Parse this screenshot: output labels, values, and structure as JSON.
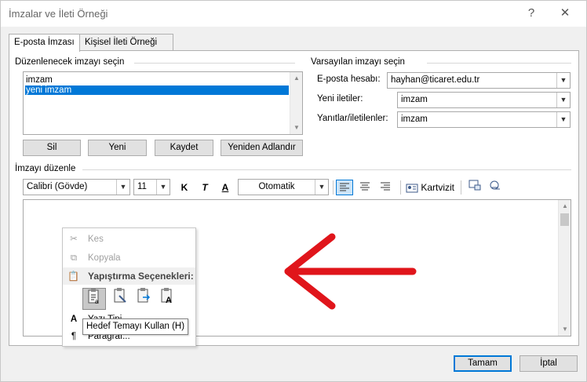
{
  "window": {
    "title": "İmzalar ve İleti Örneği",
    "help": "?",
    "close": "✕"
  },
  "tabs": [
    "E-posta İmzası",
    "Kişisel İleti Örneği"
  ],
  "select_group": {
    "label": "Düzenlenecek imzayı seçin",
    "items": [
      "imzam",
      "yeni imzam"
    ],
    "selected_index": 1
  },
  "signature_buttons": {
    "delete": "Sil",
    "new": "Yeni",
    "save": "Kaydet",
    "rename": "Yeniden Adlandır"
  },
  "default_group": {
    "label": "Varsayılan imzayı seçin",
    "account_label": "E-posta hesabı:",
    "account_value": "hayhan@ticaret.edu.tr",
    "new_label": "Yeni iletiler:",
    "new_value": "imzam",
    "reply_label": "Yanıtlar/iletilenler:",
    "reply_value": "imzam"
  },
  "edit_group": {
    "label": "İmzayı düzenle"
  },
  "toolbar": {
    "font": "Calibri (Gövde)",
    "size": "11",
    "bold": "K",
    "italic": "T",
    "font_color": "A",
    "color": "Otomatik",
    "vcard": "Kartvizit"
  },
  "context_menu": {
    "cut": "Kes",
    "copy": "Kopyala",
    "paste_header": "Yapıştırma Seçenekleri:",
    "item_partial": "Yazı Tipi...",
    "paragraph": "Paragraf..."
  },
  "tooltip": "Hedef Temayı Kullan (H)",
  "footer": {
    "ok": "Tamam",
    "cancel": "İptal"
  },
  "colors": {
    "selection": "#0078d7",
    "arrow": "#e0151b",
    "accent": "#0078d7"
  }
}
